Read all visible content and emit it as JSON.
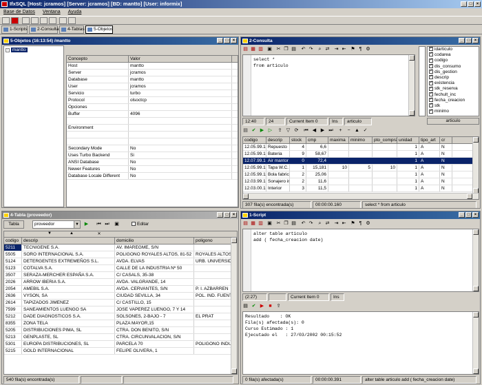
{
  "app": {
    "title": "IfxSQL [Host: jcramos] [Server: jcramos] [BD: mantto] [User: informix]",
    "menu": [
      "Base de Datos",
      "Ventana",
      "Ayuda"
    ]
  },
  "tabs": [
    {
      "label": "1-Scripts"
    },
    {
      "label": "2-Consulta"
    },
    {
      "label": "4-Tablas"
    },
    {
      "label": "5-Objetos",
      "active": true
    }
  ],
  "objects": {
    "title": "5-Objetos (16:13:54) /mantto",
    "tree_item": "mantto",
    "headers": [
      "Concepto",
      "Valor"
    ],
    "rows": [
      [
        "Host",
        "mantto"
      ],
      [
        "Server",
        "jcramos"
      ],
      [
        "Database",
        "mantto"
      ],
      [
        "User",
        "jcramos"
      ],
      [
        "Servicio",
        "turbo"
      ],
      [
        "Protocol",
        "olsoctcp"
      ],
      [
        "Opciones",
        ""
      ],
      [
        "Buffer",
        "4096"
      ],
      [
        "",
        ""
      ],
      [
        "Environment",
        ""
      ],
      [
        "",
        ""
      ],
      [
        "",
        ""
      ],
      [
        "Secondary Mode",
        "No"
      ],
      [
        "Uses Turbo Backend",
        "Si"
      ],
      [
        "ANSI Database",
        "No"
      ],
      [
        "Newer Features",
        "No"
      ],
      [
        "Database Locale Different",
        "No"
      ]
    ]
  },
  "consulta": {
    "title": "2-Consulta",
    "sql": "select *\nfrom articulo",
    "status": [
      "12:40",
      "24",
      "Current Item 0",
      "Ins",
      "articulo"
    ],
    "columns_header": "articulo",
    "columns": [
      "idarticulo",
      "codarea",
      "codigo",
      "dis_consumo",
      "dis_gestion",
      "descrip",
      "existencia",
      "stk_reserva",
      "fechult_inc",
      "fecha_creacion",
      "stk",
      "minimo"
    ],
    "grid_headers": [
      "codigo",
      "descrip",
      "stock",
      "cmp",
      "maxima",
      "minimo",
      "pto_compra",
      "unidad",
      "tipo_art",
      "cr"
    ],
    "grid_rows": [
      [
        "12.05.99.13",
        "Repuesto",
        "4",
        "6,6",
        "",
        "",
        "",
        "1",
        "A",
        "N"
      ],
      [
        "12.05.99.15",
        "Bateria",
        "9",
        "58,67",
        "",
        "",
        "",
        "1",
        "A",
        "N"
      ],
      [
        "12.07.99.14",
        "Air mantor",
        "0",
        "72,4",
        "",
        "",
        "",
        "1",
        "A",
        "N"
      ],
      [
        "12.05.99.18",
        "Tapa W.C.",
        "1",
        "15,181",
        "10",
        "5",
        "10",
        "1",
        "A",
        "N"
      ],
      [
        "12.05.99.11",
        "Bola fabric",
        "2",
        "25,06",
        "",
        "",
        "",
        "1",
        "A",
        "N"
      ],
      [
        "12.03.99.13",
        "Sonajero int",
        "2",
        "11,6",
        "",
        "",
        "",
        "1",
        "A",
        "N"
      ],
      [
        "12.03.00.19",
        "Interior",
        "3",
        "11,5",
        "",
        "",
        "",
        "1",
        "A",
        "N"
      ]
    ],
    "result_status": [
      "307 fila(s) encontrada(s)",
      "00:00:00.160",
      "select * from articulo"
    ]
  },
  "tabla": {
    "title": "4-Tabla (proveedor)",
    "label": "Tabla",
    "table_name": "proveedor",
    "editar": "Editar",
    "headers": [
      "codigo",
      "descrip",
      "domicilio",
      "poligono"
    ],
    "rows": [
      [
        "5211",
        "TECNIGENE S.A.",
        "AV. IMAREGME, S/N",
        ""
      ],
      [
        "5505",
        "SORO INTERNACIONAL S.A.",
        "POLIGONO ROYALES ALTOS, 81-52",
        "ROYALES ALTOS"
      ],
      [
        "5124",
        "DETERGENTES EXTREMEÑOS S.L.",
        "AVDA. ELVAS",
        "URB. UNIVERSIDAD"
      ],
      [
        "5123",
        "COTALVA S.A.",
        "CALLE DE LA INDUSTRIA Nº 50",
        ""
      ],
      [
        "3507",
        "SERAZA-MERCHER ESPAÑA S.A.",
        "C/ CASALS, 35-38",
        ""
      ],
      [
        "2026",
        "ARROW IBERIA S.A.",
        "AVDA. VALGRANDE, 14",
        ""
      ],
      [
        "2054",
        "AMEBIL S.A.",
        "AVDA. CERVANTES, S/N",
        "P. I. AZBARREN"
      ],
      [
        "2636",
        "VYSON, SA",
        "CIUDAD SEVILLA, 34",
        "POL. IND. FUENTEHENDIDA"
      ],
      [
        "2614",
        "TAPIZADOS JIMENEZ",
        "C/ CASTILLO, 15",
        ""
      ],
      [
        "7599",
        "SANEAMIENTOS LUENGO SA",
        "JOSE VAPEREZ LUENGO, 7 Y 14",
        ""
      ],
      [
        "5212",
        "DADE DIAGNOSTICOS S.A.",
        "SOLSONES, 2-BAJO - 7",
        "EL PRAT"
      ],
      [
        "8355",
        "ZONA TELA",
        "PLAZA MAYOR,15",
        ""
      ],
      [
        "5205",
        "DISTRIBUCIONES PIMA, SL",
        "CTRA. DON BENITO, S/N",
        ""
      ],
      [
        "5213",
        "GENPLASTE, SL",
        "CTRA. CIRCUNVALACION, S/N",
        ""
      ],
      [
        "5301",
        "EUROPA DISTRIBUCIONES, SL",
        "PARCELA 70",
        "POLIGONO INDUSTRIAL"
      ],
      [
        "5215",
        "GOLD INTERNACIONAL",
        "FELIPE OLIVERA, 1",
        ""
      ]
    ],
    "status": "540 fila(s) encontrada(s)"
  },
  "script": {
    "title": "1-Script",
    "sql": "alter table articulo\nadd ( fecha_creacion date)",
    "status": [
      "(2:27)",
      "",
      "Current Item 0",
      "Ins"
    ],
    "output": "Resultado    : OK\nFila(s) afectada(s): 0\nCurso Estimado : 1\nEjecutado el   : 27/03/2002 00:15:52",
    "result_status": [
      "0 fila(s) afectada(s)",
      "00:00:00.391",
      "alter table articulo add ( fecha_creacion date)"
    ]
  }
}
